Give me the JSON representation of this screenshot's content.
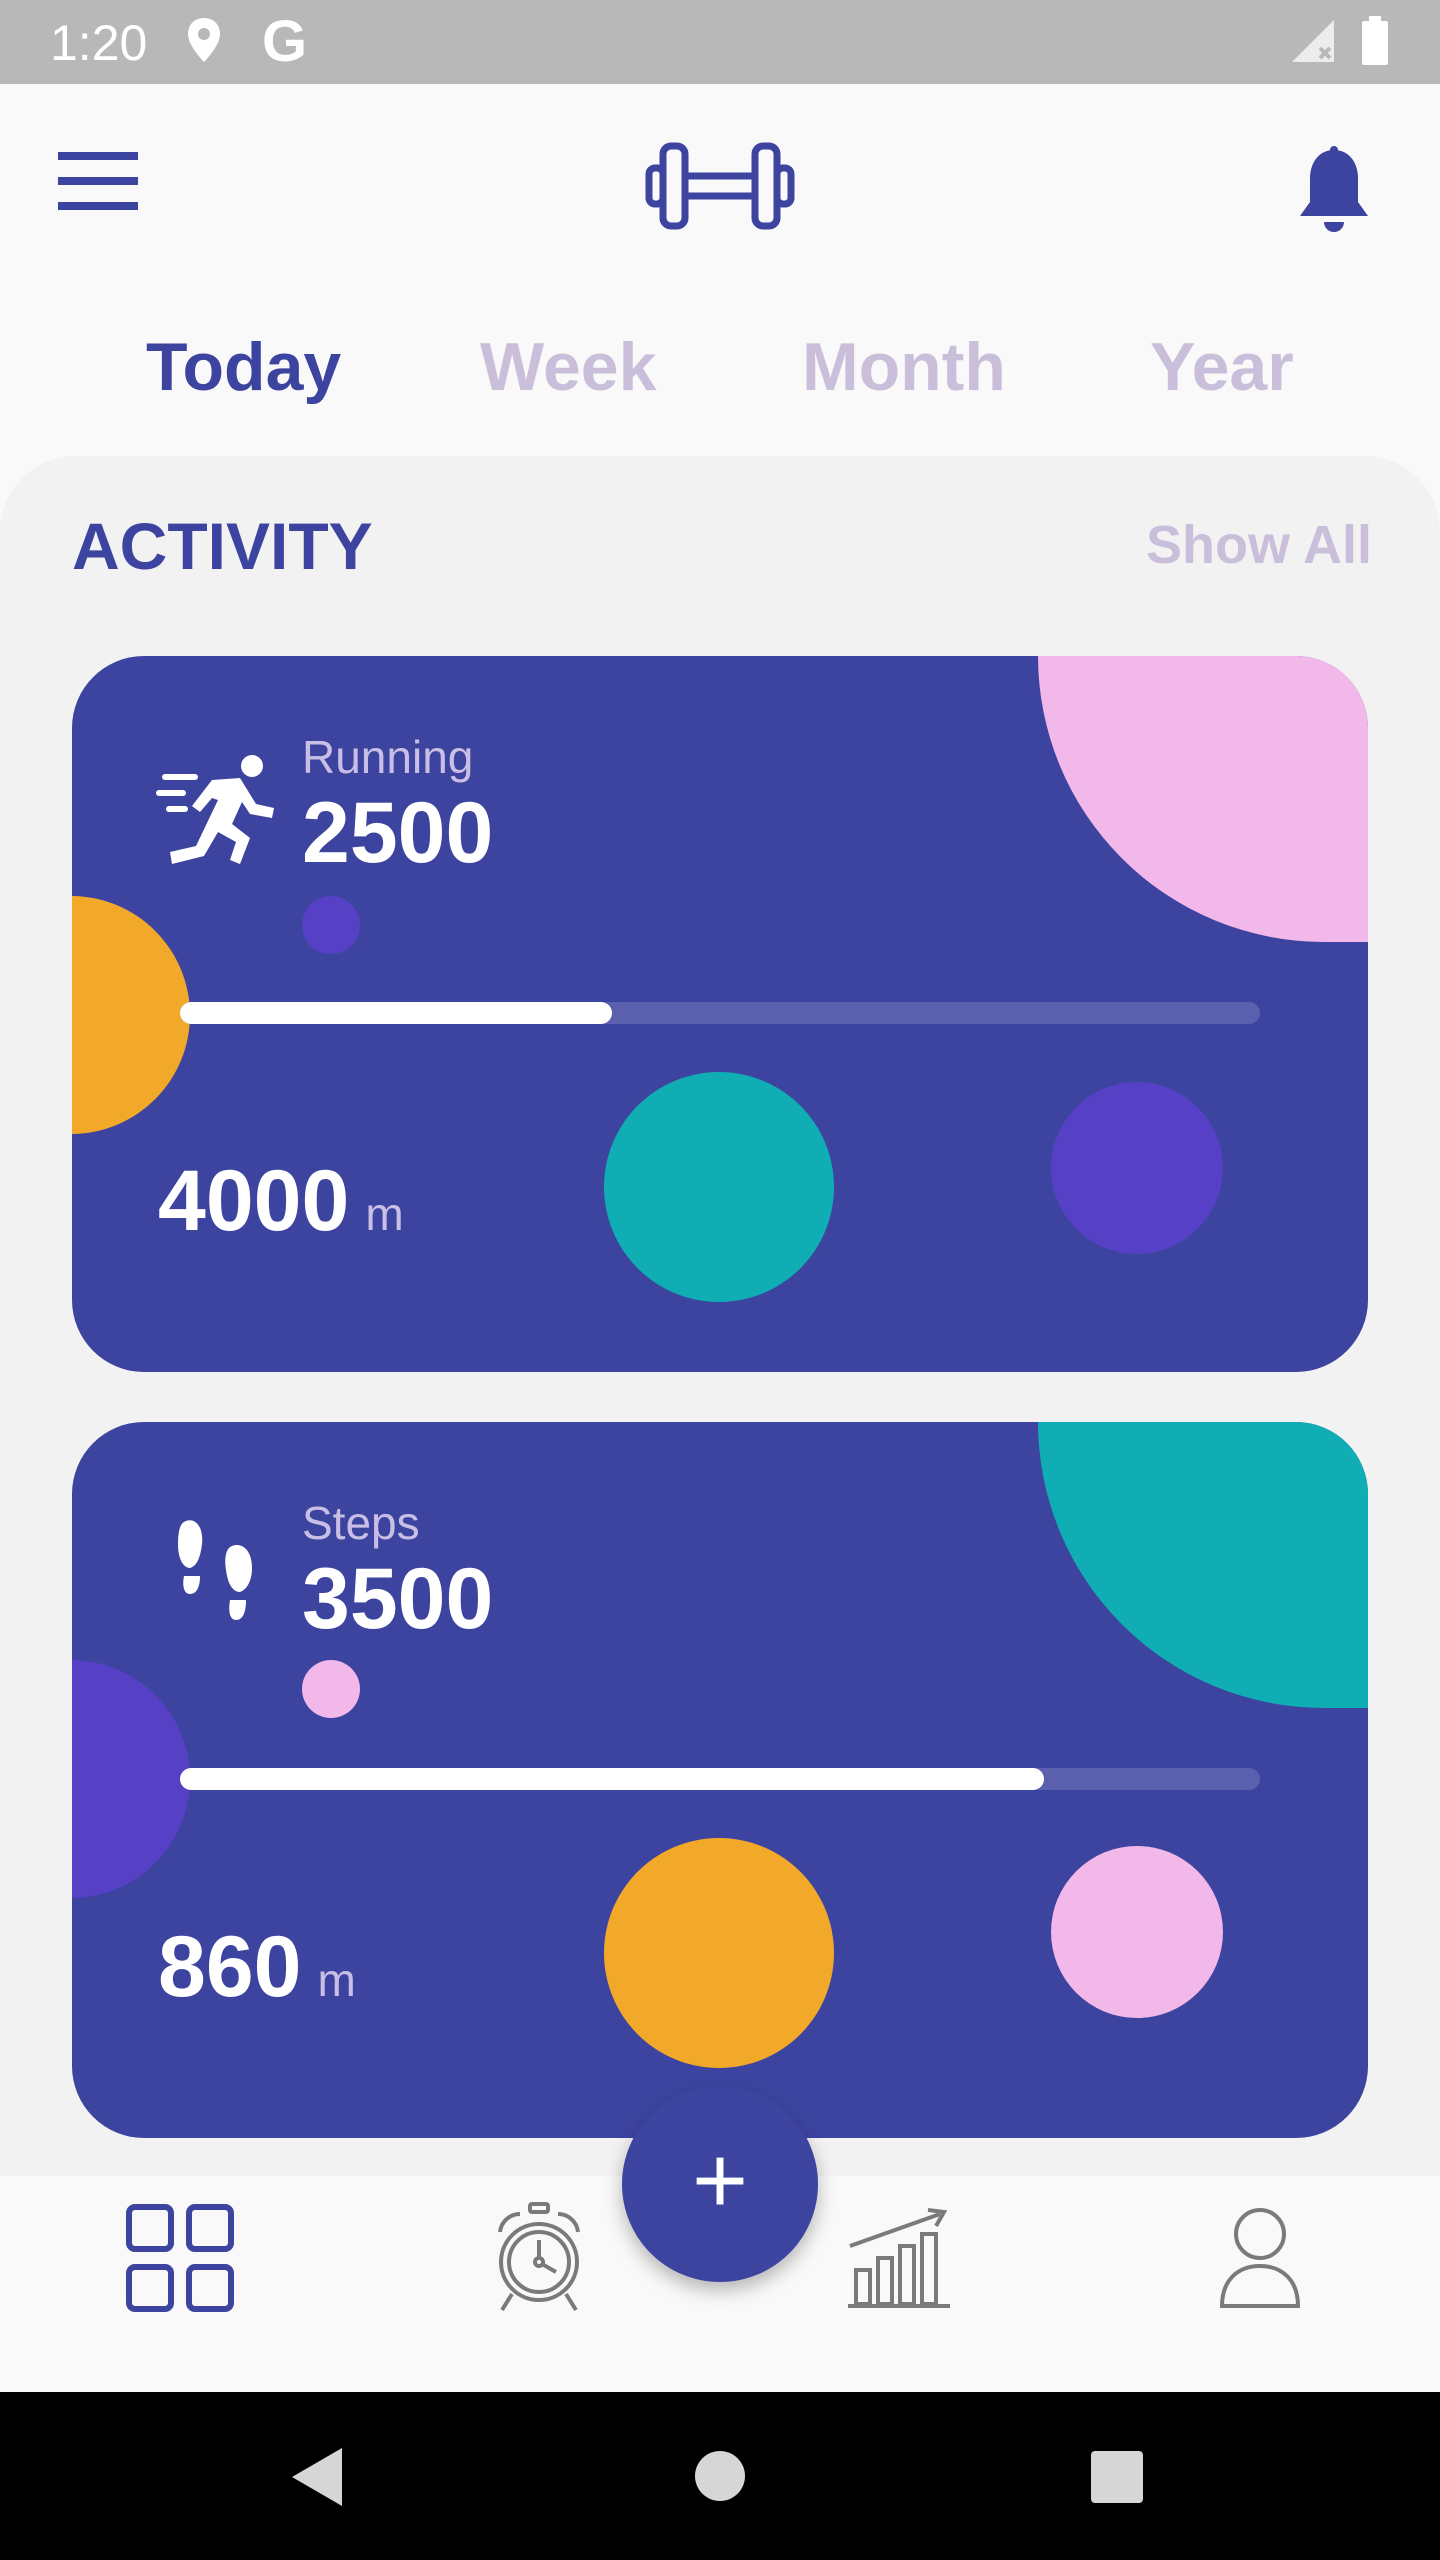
{
  "status_bar": {
    "time": "1:20",
    "g_letter": "G",
    "icons": [
      "location-icon",
      "signal-icon",
      "battery-icon"
    ]
  },
  "app_bar": {
    "icons": [
      "menu-icon",
      "dumbbell-icon",
      "bell-icon"
    ]
  },
  "tabs": [
    {
      "label": "Today",
      "active": true
    },
    {
      "label": "Week",
      "active": false
    },
    {
      "label": "Month",
      "active": false
    },
    {
      "label": "Year",
      "active": false
    }
  ],
  "activity": {
    "title": "ACTIVITY",
    "show_all": "Show All",
    "cards": [
      {
        "icon": "running-icon",
        "label": "Running",
        "value": "2500",
        "distance": "4000",
        "unit": "m",
        "progress": 0.4,
        "colors": {
          "card": "#3c44a0",
          "quarter": "#f2b8ea",
          "side": "#f2a828",
          "dot": "#5540c6",
          "big": "#10aeb4",
          "mid": "#5540c6"
        }
      },
      {
        "icon": "footprints-icon",
        "label": "Steps",
        "value": "3500",
        "distance": "860",
        "unit": "m",
        "progress": 0.8,
        "colors": {
          "card": "#3c44a0",
          "quarter": "#10aeb4",
          "side": "#5540c6",
          "dot": "#f2b8ea",
          "big": "#f2a828",
          "mid": "#f2b8ea"
        }
      }
    ]
  },
  "fab": {
    "label": "+"
  },
  "bottom_nav": {
    "items": [
      "grid-icon",
      "alarm-clock-icon",
      "chart-icon",
      "profile-icon"
    ]
  },
  "system_nav": {
    "items": [
      "back-icon",
      "home-icon",
      "recents-icon"
    ]
  }
}
